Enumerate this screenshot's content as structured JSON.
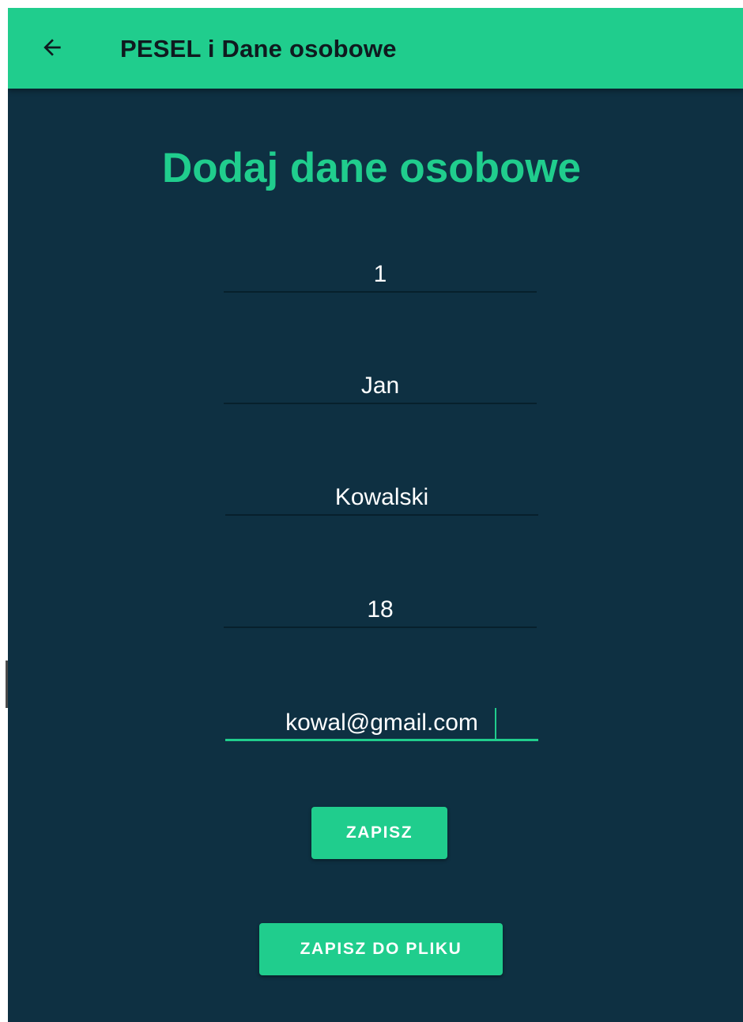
{
  "appbar": {
    "title": "PESEL i Dane osobowe",
    "back_icon": "arrow-left-icon",
    "color": "#20cd8d"
  },
  "form": {
    "heading": "Dodaj dane osobowe",
    "fields": [
      {
        "name": "pesel",
        "value": "1"
      },
      {
        "name": "first-name",
        "value": "Jan"
      },
      {
        "name": "last-name",
        "value": "Kowalski"
      },
      {
        "name": "age",
        "value": "18"
      },
      {
        "name": "email",
        "value": "kowal@gmail.com",
        "focused": true
      }
    ]
  },
  "buttons": {
    "save_label": "ZAPISZ",
    "save_to_file_label": "ZAPISZ DO PLIKU"
  },
  "colors": {
    "background": "#0e3042",
    "accent": "#20cd8d",
    "text": "#ffffff"
  }
}
